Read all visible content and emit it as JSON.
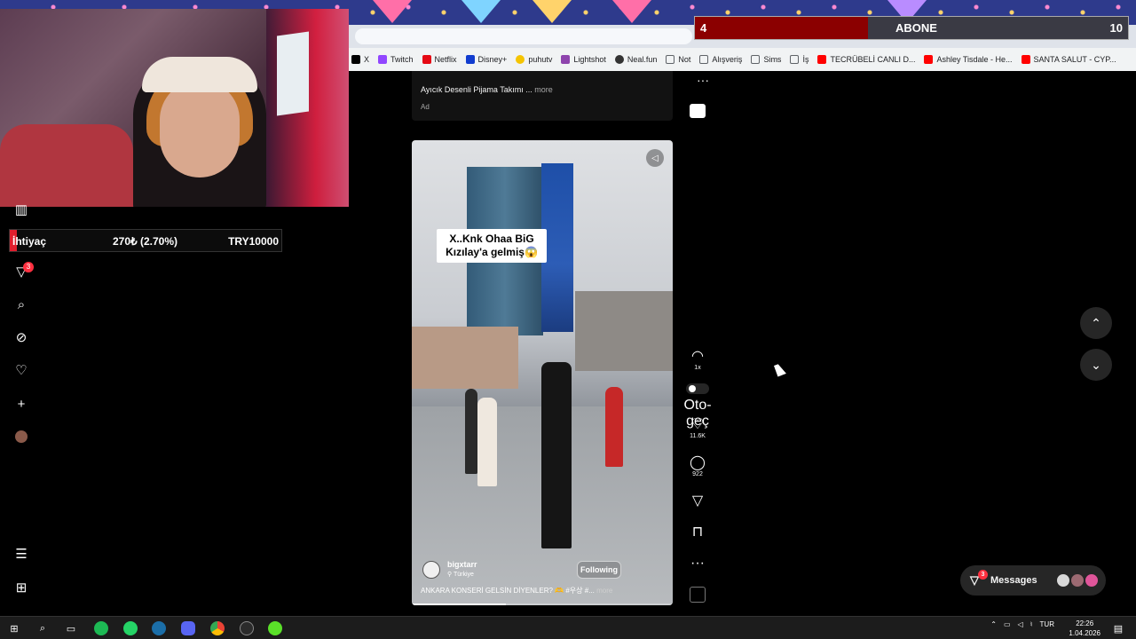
{
  "overlay": {
    "abone_count": "4",
    "abone_label": "ABONE",
    "abone_goal": "10",
    "abone_fill_fraction": 0.4,
    "donation_label": "İhtiyaç",
    "donation_progress": "270₺ (2.70%)",
    "donation_goal": "TRY10000",
    "donation_fill_fraction": 0.027
  },
  "bookmarks": [
    {
      "label": "X",
      "color": "#000000"
    },
    {
      "label": "Twitch",
      "color": "#9146ff"
    },
    {
      "label": "Netflix",
      "color": "#e50914"
    },
    {
      "label": "Disney+",
      "color": "#113ccf"
    },
    {
      "label": "puhutv",
      "color": "#f5c400"
    },
    {
      "label": "Lightshot",
      "color": "#8e44ad"
    },
    {
      "label": "Neal.fun",
      "color": "#333333"
    },
    {
      "label": "Not",
      "color": "#5f6368"
    },
    {
      "label": "Alışveriş",
      "color": "#5f6368"
    },
    {
      "label": "Sims",
      "color": "#5f6368"
    },
    {
      "label": "İş",
      "color": "#5f6368"
    },
    {
      "label": "TECRÜBELİ CANLI D...",
      "color": "#ff0000"
    },
    {
      "label": "Ashley Tisdale - He...",
      "color": "#ff0000"
    },
    {
      "label": "SANTA SALUT - CYP...",
      "color": "#ff0000"
    }
  ],
  "sidebar": {
    "notifications_badge": "3"
  },
  "prev_post": {
    "caption": "Ayıcık Desenli Pijama Takımı ...",
    "more": "more",
    "ad_label": "Ad"
  },
  "reel": {
    "overlay_text": "X..Knk Ohaa BiG Kızılay'a gelmiş😱",
    "author": "bigxtarr",
    "location": "Türkiye",
    "follow_label": "Following",
    "caption": "ANKARA KONSERİ GELSİN DİYENLER? 🫶 #우상 #...",
    "more": "more",
    "progress_fraction": 0.36
  },
  "actions": {
    "speed": "1x",
    "autoscroll_label": "Oto-geç",
    "likes": "11.6K",
    "comments": "922"
  },
  "messages": {
    "label": "Messages",
    "badge": "3"
  },
  "taskbar": {
    "lang": "TUR",
    "time": "22:26",
    "date": "1.04.2026"
  }
}
